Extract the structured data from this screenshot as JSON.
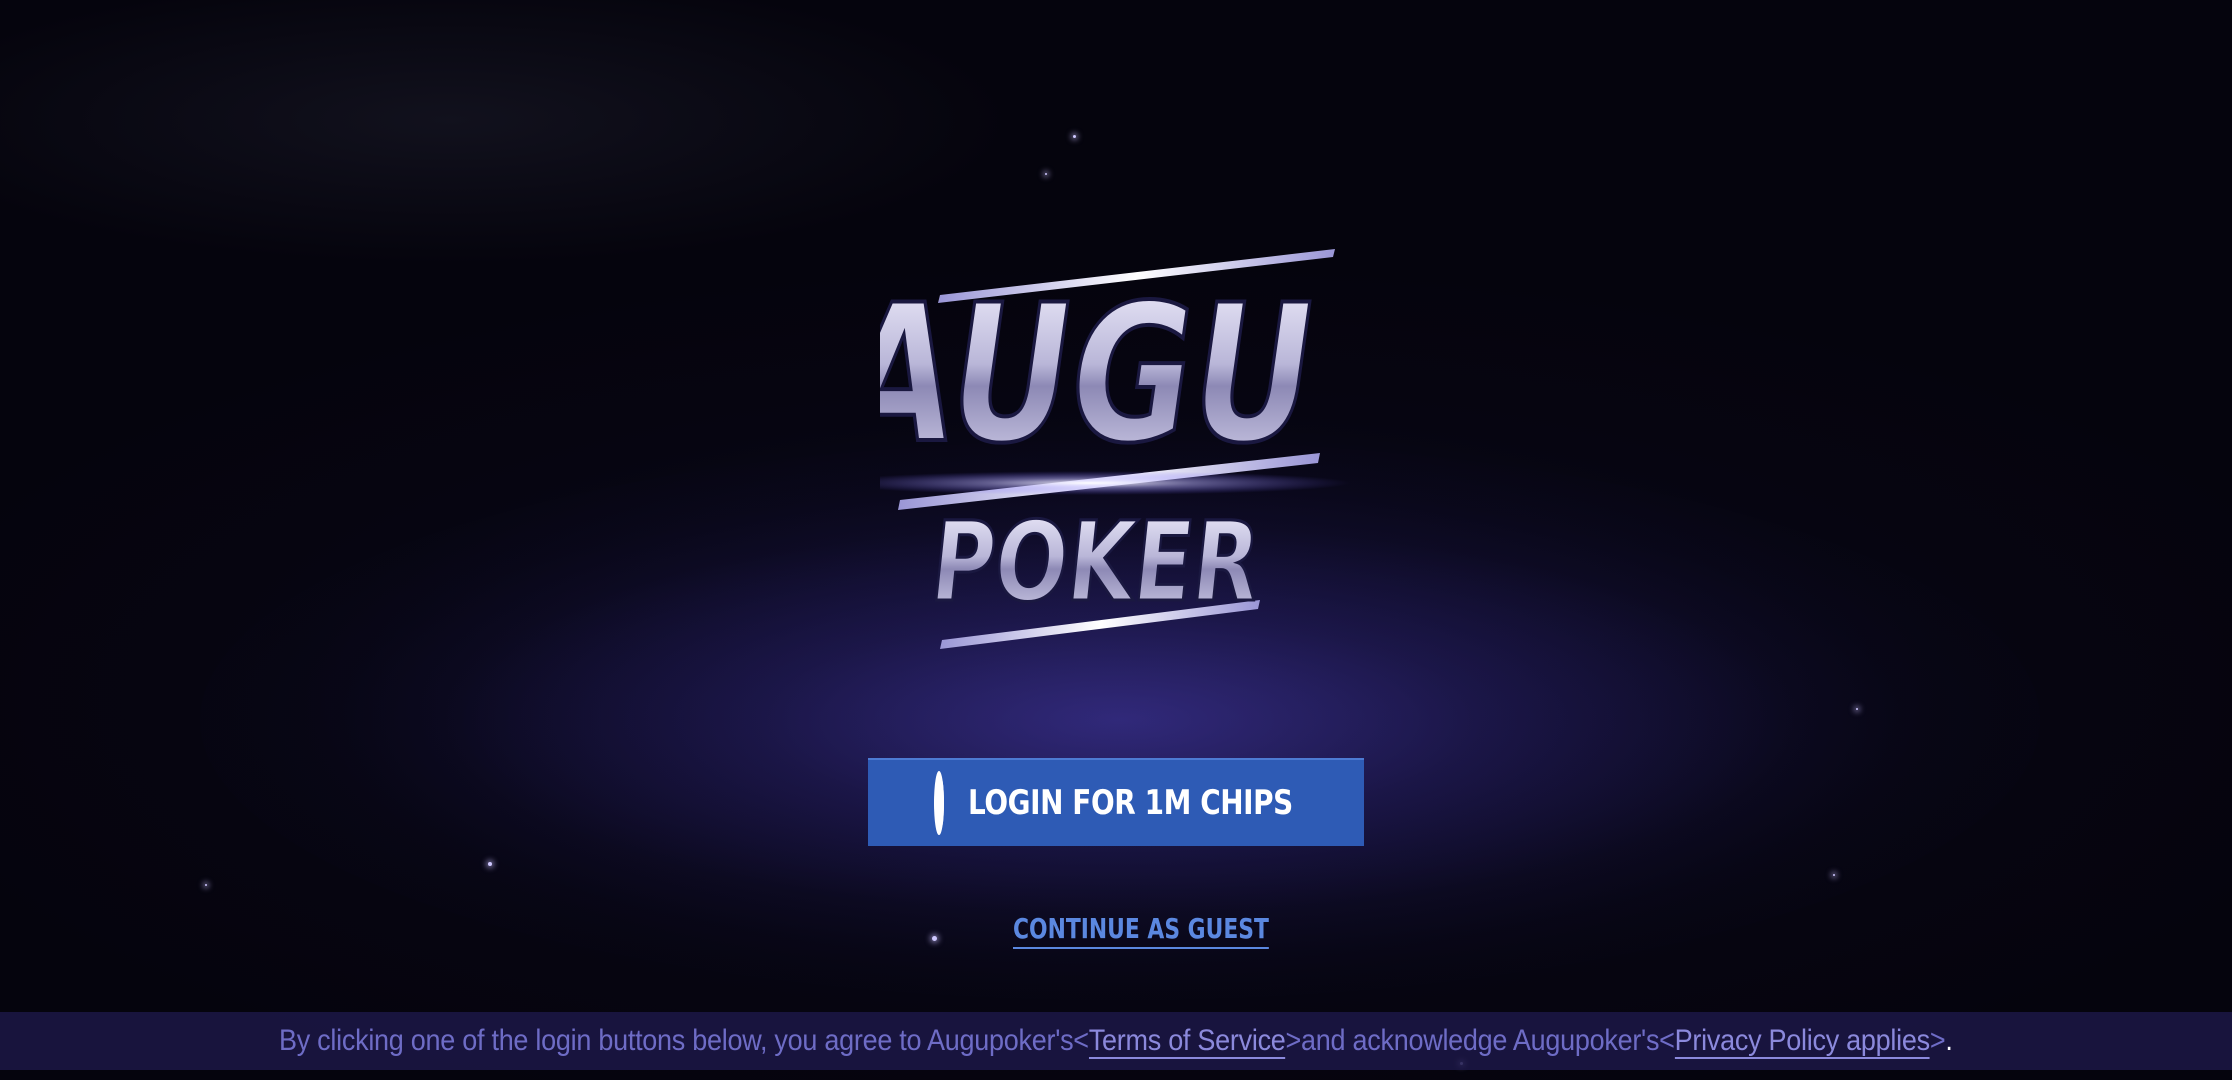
{
  "logo": {
    "line1": "AUGU",
    "line2": "POKER"
  },
  "login": {
    "facebook_label": "LOGIN FOR 1M CHIPS",
    "facebook_icon": "facebook-icon",
    "guest_label": "CONTINUE AS GUEST"
  },
  "footer": {
    "prefix": "By clicking one of the login buttons below, you agree to Augupoker's<",
    "terms_link": "Terms of Service",
    "middle": ">and acknowledge Augupoker's<",
    "privacy_link": "Privacy Policy applies",
    "suffix": ">",
    "period": "."
  },
  "colors": {
    "background": "#05040d",
    "facebook_button": "#2e5bb5",
    "guest_link": "#5b88e0",
    "footer_bar": "#1c1846",
    "footer_text": "#6e6cc6"
  }
}
